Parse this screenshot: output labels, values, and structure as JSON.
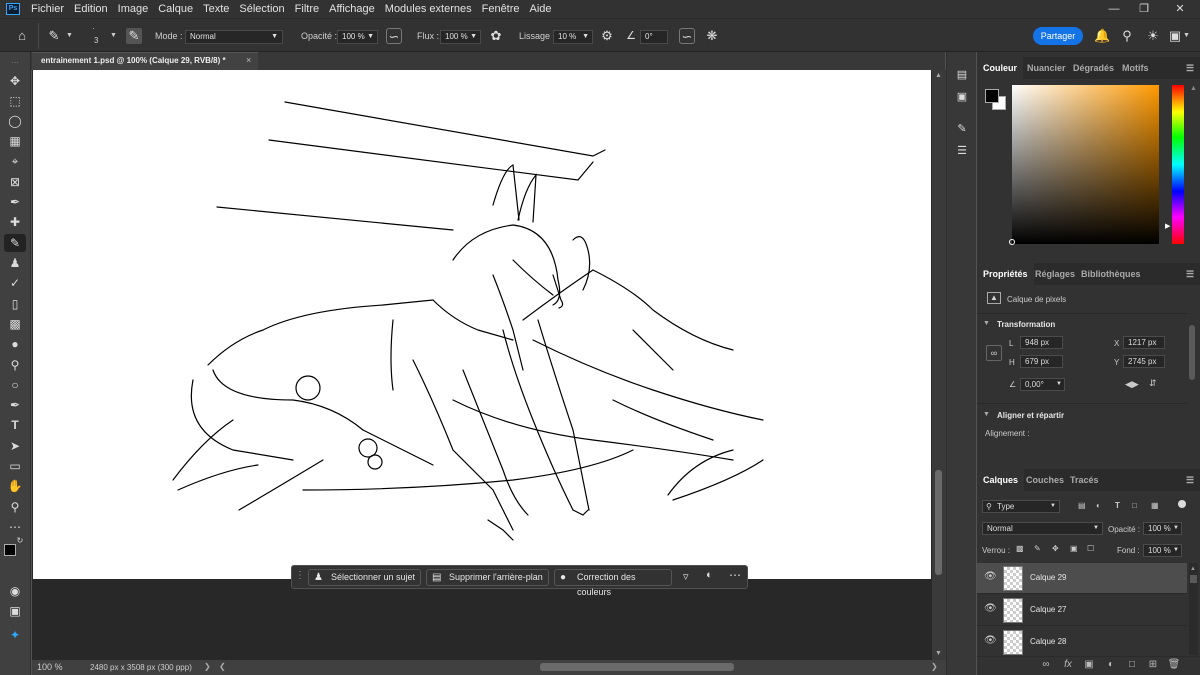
{
  "menu": {
    "app_icon": "Ps",
    "items": [
      "Fichier",
      "Edition",
      "Image",
      "Calque",
      "Texte",
      "Sélection",
      "Filtre",
      "Affichage",
      "Modules externes",
      "Fenêtre",
      "Aide"
    ]
  },
  "options": {
    "brush_size": "3",
    "mode_label": "Mode :",
    "mode_value": "Normal",
    "opacity_label": "Opacité :",
    "opacity_value": "100 %",
    "flow_label": "Flux :",
    "flow_value": "100 %",
    "smoothing_label": "Lissage :",
    "smoothing_value": "10 %",
    "angle_value": "0°",
    "share_label": "Partager"
  },
  "document": {
    "tab_title": "entrainement 1.psd @ 100% (Calque 29, RVB/8) *",
    "close_glyph": "×",
    "zoom": "100 %",
    "doc_info": "2480 px x 3508 px (300 ppp)"
  },
  "taskbar": {
    "select_subject": "Sélectionner un sujet",
    "remove_background": "Supprimer l'arrière-plan",
    "color_correction": "Correction des couleurs"
  },
  "color_panel": {
    "tabs": [
      "Couleur",
      "Nuancier",
      "Dégradés",
      "Motifs"
    ],
    "foreground": "#000000",
    "background": "#ffffff",
    "picker_hue": "#ff9900"
  },
  "properties_panel": {
    "tabs": [
      "Propriétés",
      "Réglages",
      "Bibliothèques"
    ],
    "pixel_layer": "Calque de pixels",
    "transform_title": "Transformation",
    "w_label": "L",
    "w_value": "948 px",
    "h_label": "H",
    "h_value": "679 px",
    "x_label": "X",
    "x_value": "1217 px",
    "y_label": "Y",
    "y_value": "2745 px",
    "angle_value": "0,00°",
    "align_title": "Aligner et répartir",
    "align_label": "Alignement :"
  },
  "layers_panel": {
    "tabs": [
      "Calques",
      "Couches",
      "Tracés"
    ],
    "filter_type": "Type",
    "blend_mode": "Normal",
    "opacity_label": "Opacité :",
    "opacity_value": "100 %",
    "lock_label": "Verrou :",
    "fill_label": "Fond :",
    "fill_value": "100 %",
    "layers": [
      {
        "name": "Calque 29",
        "selected": true
      },
      {
        "name": "Calque 27",
        "selected": false
      },
      {
        "name": "Calque 28",
        "selected": false
      }
    ]
  }
}
